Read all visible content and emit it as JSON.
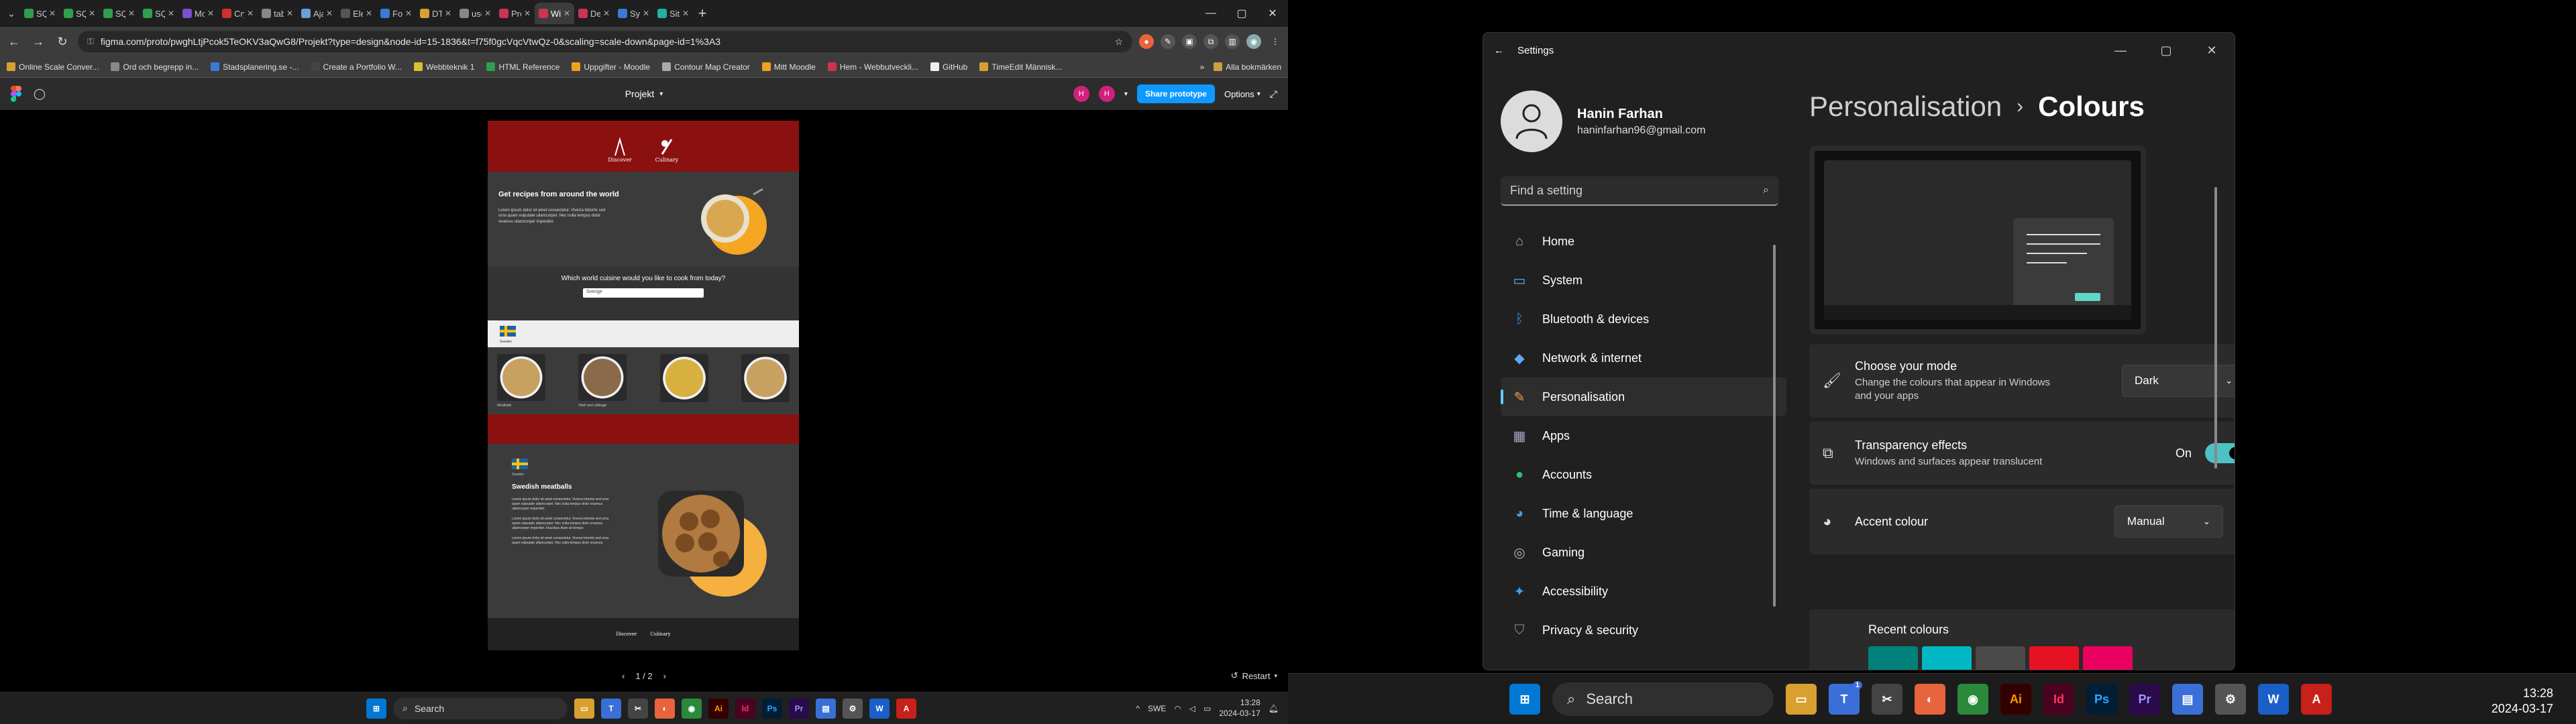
{
  "browser": {
    "tabs": [
      {
        "label": "SQL",
        "color": "#2e9e4f"
      },
      {
        "label": "SQL",
        "color": "#2e9e4f"
      },
      {
        "label": "SQL",
        "color": "#2e9e4f"
      },
      {
        "label": "SQL",
        "color": "#2e9e4f"
      },
      {
        "label": "Mo",
        "color": "#7a4fd0"
      },
      {
        "label": "Cry",
        "color": "#d03030"
      },
      {
        "label": "tab",
        "color": "#888888"
      },
      {
        "label": "Aja",
        "color": "#6aa0d8"
      },
      {
        "label": "Ele",
        "color": "#555555"
      },
      {
        "label": "For",
        "color": "#3a7bd5"
      },
      {
        "label": "DT",
        "color": "#d8a030"
      },
      {
        "label": "use",
        "color": "#888888"
      },
      {
        "label": "Pro",
        "color": "#cc3355"
      },
      {
        "label": "Wir",
        "color": "#cc3355",
        "active": true
      },
      {
        "label": "Des",
        "color": "#cc3355"
      },
      {
        "label": "Syn",
        "color": "#3a7bd5"
      },
      {
        "label": "Site",
        "color": "#20b0a0"
      }
    ],
    "url": "figma.com/proto/pwghLtjPcok5TeOKV3aQwG8/Projekt?type=design&node-id=15-1836&t=f75f0gcVqcVtwQz-0&scaling=scale-down&page-id=1%3A3",
    "bookmarks": [
      {
        "label": "Online Scale Conver...",
        "color": "#d8a030"
      },
      {
        "label": "Ord och begrepp in...",
        "color": "#888888"
      },
      {
        "label": "Stadsplanering.se -...",
        "color": "#3a7bd5"
      },
      {
        "label": "Create a Portfolio W...",
        "color": "#444444"
      },
      {
        "label": "Webbteknik 1",
        "color": "#d8c030"
      },
      {
        "label": "HTML Reference",
        "color": "#2e9e4f"
      },
      {
        "label": "Uppgifter - Moodle",
        "color": "#f0a020"
      },
      {
        "label": "Contour Map Creator",
        "color": "#aaaaaa"
      },
      {
        "label": "Mitt Moodle",
        "color": "#f0a020"
      },
      {
        "label": "Hem - Webbutveckli...",
        "color": "#cc3355"
      },
      {
        "label": "GitHub",
        "color": "#eeeeee"
      },
      {
        "label": "TimeEdit Människ...",
        "color": "#d8a030"
      }
    ],
    "bookmarks_overflow": "»",
    "all_bookmarks": "Alla bokmärken"
  },
  "figma": {
    "file_title": "Projekt",
    "avatars": [
      "H",
      "H"
    ],
    "share_label": "Share prototype",
    "options_label": "Options",
    "pager": "1 / 2",
    "restart_label": "Restart"
  },
  "prototype": {
    "logo_left": "Discover",
    "logo_right": "Culinary",
    "hero_title": "Get recipes from around the world",
    "hero_text": "Lorem ipsum dolor sit amet consectetur. Viverra lobortis sed urna quam vulputate ullamcorper. Nec nulla tempus dolor vivamus ullamcorper imperdiet.",
    "question": "Which world cuisine would you like to cook from today?",
    "input_value": "Sverige",
    "flag_caption": "Sweden",
    "cards": [
      {
        "caption": "Meatballs",
        "color": "#c8a060"
      },
      {
        "caption": "Hash and cabbage",
        "color": "#8a6a4a"
      },
      {
        "caption": "",
        "color": "#d8b040"
      },
      {
        "caption": "",
        "color": "#c8a060"
      }
    ],
    "detail_flag_caption": "Sweden",
    "detail_title": "Swedish meatballs",
    "detail_p1": "Lorem ipsum dolor sit amet consectetur. Viverra lobortis sed urna quam vulputate ullamcorper. Nec nulla tempus dolor vivamus ullamcorper imperdiet.",
    "detail_p2": "Lorem ipsum dolor sit amet consectetur. Viverra lobortis sed urna quam vulputate ullamcorper. Nec nulla tempus dolor vivamus ullamcorper imperdiet. Faucibus diam sit tempor.",
    "detail_p3": "Lorem ipsum dolor sit amet consectetur. Viverra lobortis sed urna quam vulputate ullamcorper. Nec nulla tempus dolor vivamus.",
    "footer_left": "Discover",
    "footer_right": "Culinary"
  },
  "taskbar_left": {
    "search": "Search",
    "lang": "SWE",
    "time": "13:28",
    "date": "2024-03-17"
  },
  "settings": {
    "window_title": "Settings",
    "user_name": "Hanin Farhan",
    "user_email": "haninfarhan96@gmail.com",
    "search_placeholder": "Find a setting",
    "nav": [
      {
        "label": "Home",
        "icon": "home-icon"
      },
      {
        "label": "System",
        "icon": "system-icon"
      },
      {
        "label": "Bluetooth & devices",
        "icon": "bluetooth-icon"
      },
      {
        "label": "Network & internet",
        "icon": "network-icon"
      },
      {
        "label": "Personalisation",
        "icon": "brush-icon",
        "active": true
      },
      {
        "label": "Apps",
        "icon": "apps-icon"
      },
      {
        "label": "Accounts",
        "icon": "accounts-icon"
      },
      {
        "label": "Time & language",
        "icon": "globe-icon"
      },
      {
        "label": "Gaming",
        "icon": "gaming-icon"
      },
      {
        "label": "Accessibility",
        "icon": "accessibility-icon"
      },
      {
        "label": "Privacy & security",
        "icon": "shield-icon"
      }
    ],
    "breadcrumb_parent": "Personalisation",
    "breadcrumb_sep": "›",
    "breadcrumb_current": "Colours",
    "mode_title": "Choose your mode",
    "mode_desc": "Change the colours that appear in Windows and your apps",
    "mode_value": "Dark",
    "transparency_title": "Transparency effects",
    "transparency_desc": "Windows and surfaces appear translucent",
    "transparency_state": "On",
    "accent_title": "Accent colour",
    "accent_value": "Manual",
    "recent_title": "Recent colours",
    "recent_colours": [
      "#00807a",
      "#00b7c3",
      "#4c4a48",
      "#e81123",
      "#ea005e"
    ],
    "accent_color": "#60cdff"
  },
  "taskbar_right": {
    "search": "Search",
    "time": "13:28",
    "date": "2024-03-17",
    "badge": "1"
  }
}
